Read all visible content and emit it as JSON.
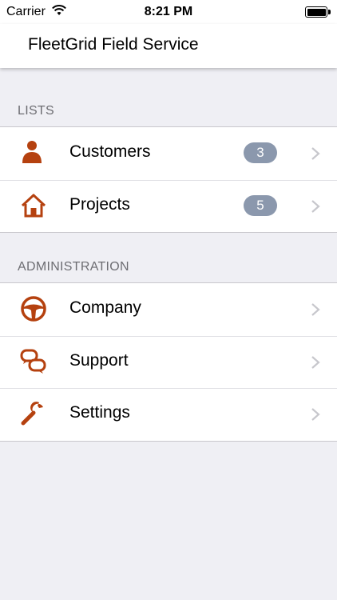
{
  "status_bar": {
    "carrier": "Carrier",
    "time": "8:21 PM"
  },
  "nav": {
    "title": "FleetGrid Field Service"
  },
  "accent_color": "#b5410f",
  "sections": [
    {
      "header": "LISTS",
      "items": [
        {
          "label": "Customers",
          "icon": "person-icon",
          "badge": "3"
        },
        {
          "label": "Projects",
          "icon": "house-icon",
          "badge": "5"
        }
      ]
    },
    {
      "header": "ADMINISTRATION",
      "items": [
        {
          "label": "Company",
          "icon": "steering-wheel-icon"
        },
        {
          "label": "Support",
          "icon": "chat-bubbles-icon"
        },
        {
          "label": "Settings",
          "icon": "wrench-icon"
        }
      ]
    }
  ]
}
